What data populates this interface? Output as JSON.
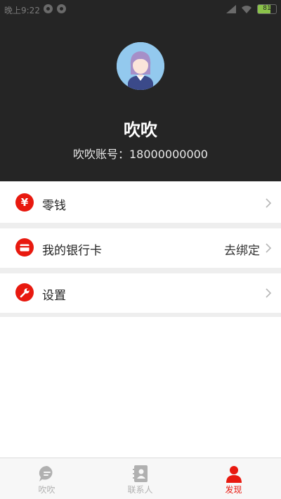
{
  "status_bar": {
    "time": "晚上9:22",
    "battery": "81"
  },
  "profile": {
    "name": "吹吹",
    "account_label": "吹吹账号：18000000000"
  },
  "menu": {
    "items": [
      {
        "label": "零钱",
        "value": "",
        "icon": "yen-icon"
      },
      {
        "label": "我的银行卡",
        "value": "去绑定",
        "icon": "card-icon"
      },
      {
        "label": "设置",
        "value": "",
        "icon": "wrench-icon"
      }
    ]
  },
  "tabs": [
    {
      "label": "吹吹",
      "icon": "chat-icon",
      "active": false
    },
    {
      "label": "联系人",
      "icon": "contacts-icon",
      "active": false
    },
    {
      "label": "发现",
      "icon": "person-icon",
      "active": true
    }
  ],
  "colors": {
    "accent": "#e8190f",
    "header_bg": "#252525",
    "tab_inactive": "#b0b0b0"
  }
}
